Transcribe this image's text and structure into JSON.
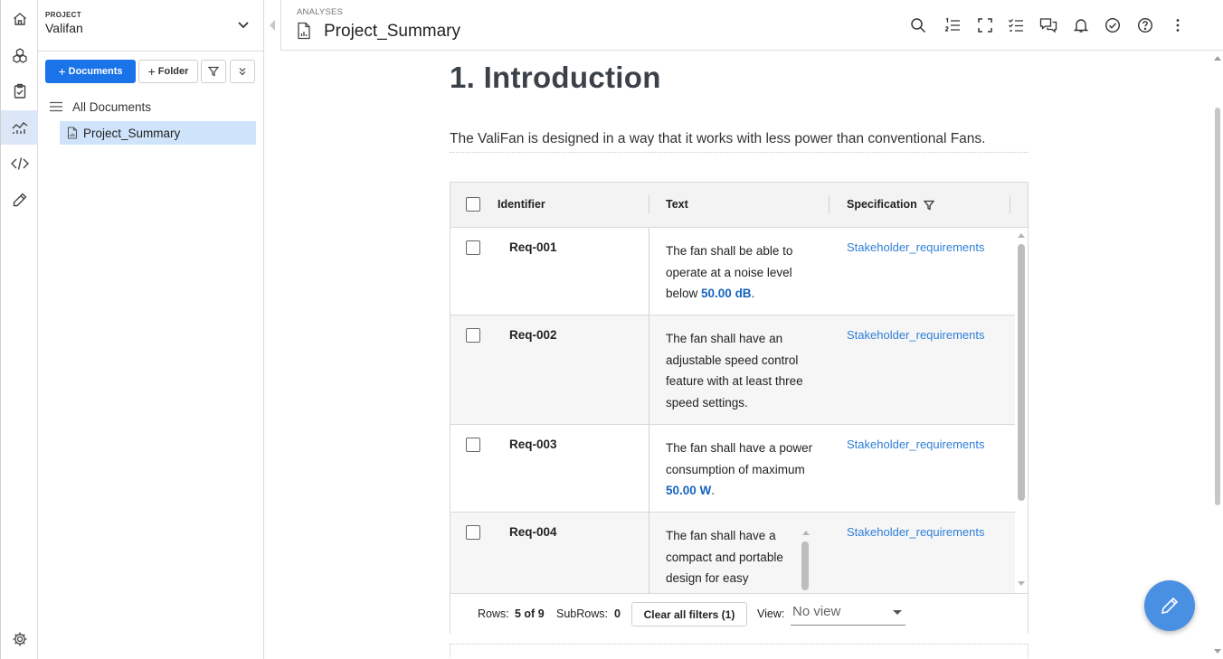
{
  "project": {
    "label": "PROJECT",
    "name": "Valifan"
  },
  "panel": {
    "documents_btn": "Documents",
    "folder_btn": "Folder",
    "tree_root": "All Documents",
    "tree_item": "Project_Summary"
  },
  "header": {
    "breadcrumb": "ANALYSES",
    "title": "Project_Summary"
  },
  "content": {
    "heading": "1. Introduction",
    "paragraph": "The ValiFan is designed in a way that it works with less power than conventional Fans."
  },
  "table": {
    "headers": {
      "identifier": "Identifier",
      "text": "Text",
      "specification": "Specification"
    },
    "rows": [
      {
        "id": "Req-001",
        "text_pre": "The fan shall be able to operate at a noise level below ",
        "value": "50.00  dB",
        "text_post": ".",
        "spec": "Stakeholder_requirements"
      },
      {
        "id": "Req-002",
        "text_pre": "The fan shall have an adjustable speed control feature with at least three speed settings.",
        "value": "",
        "text_post": "",
        "spec": "Stakeholder_requirements"
      },
      {
        "id": "Req-003",
        "text_pre": "The fan shall have a power consumption of maximum ",
        "value": "50.00  W",
        "text_post": ".",
        "spec": "Stakeholder_requirements"
      },
      {
        "id": "Req-004",
        "text_pre": "The fan shall have a compact and portable design for easy",
        "value": "",
        "text_post": "",
        "spec": "Stakeholder_requirements"
      }
    ],
    "footer": {
      "rows_label": "Rows:",
      "rows_value": "5 of 9",
      "subrows_label": "SubRows:",
      "subrows_value": "0",
      "clear_filters": "Clear all filters (1)",
      "view_label": "View:",
      "view_value": "No view"
    }
  },
  "colors": {
    "accent": "#1a73e8",
    "selected": "#cfe4fb",
    "link": "#2f7fd6",
    "fab": "#4a90e2"
  }
}
